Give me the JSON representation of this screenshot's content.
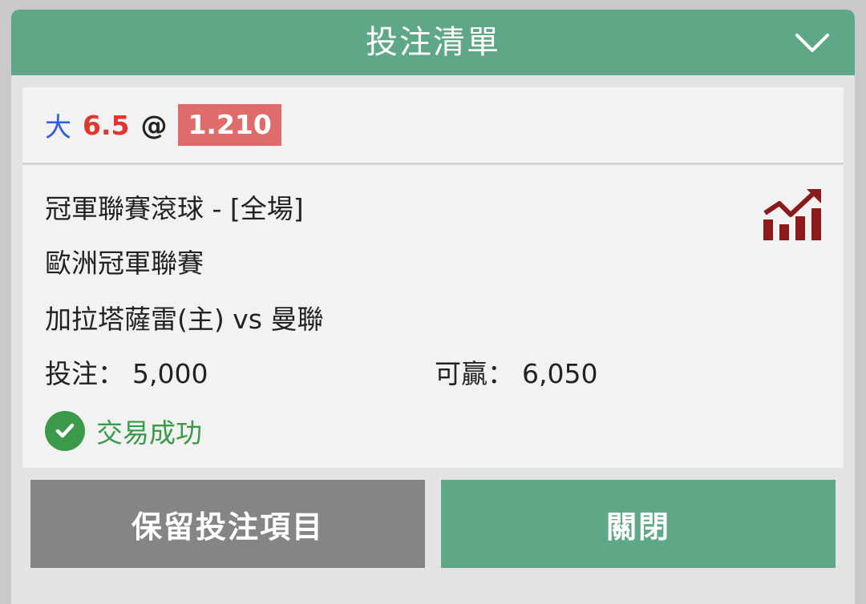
{
  "header": {
    "title": "投注清單"
  },
  "selection": {
    "side": "大",
    "handicap": "6.5",
    "at": "@",
    "odds": "1.210"
  },
  "bet": {
    "market": "冠軍聯賽滾球 - [全場]",
    "league": "歐洲冠軍聯賽",
    "match": "加拉塔薩雷(主) vs 曼聯",
    "stake_label": "投注：",
    "stake_value": "5,000",
    "win_label": "可贏：",
    "win_value": "6,050",
    "status": "交易成功"
  },
  "actions": {
    "keep_label": "保留投注項目",
    "close_label": "關閉"
  },
  "icons": {
    "collapse": "chevron-down-icon",
    "stats": "stats-chart-icon",
    "success": "check-circle-icon"
  },
  "colors": {
    "header_green": "#5ea888",
    "odds_badge": "#e06b6b",
    "handicap_red": "#e0362d",
    "side_blue": "#2c5fd8",
    "success_green": "#3a9a4a",
    "stats_icon": "#8b1a1a",
    "keep_button_gray": "#858585"
  }
}
